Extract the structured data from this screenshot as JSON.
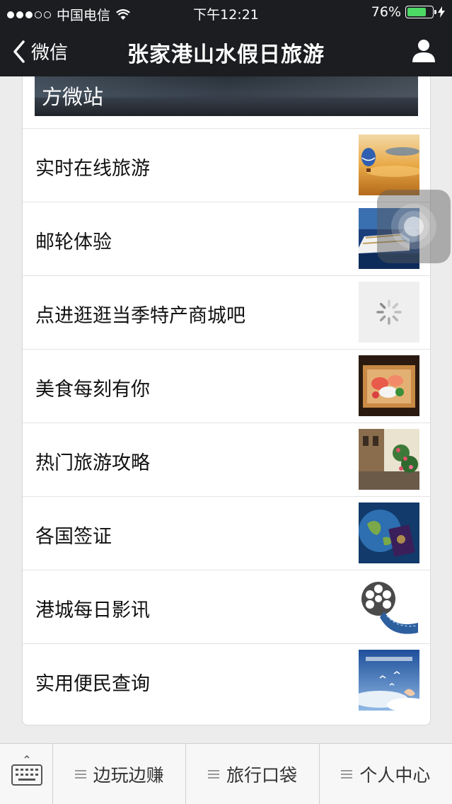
{
  "status_bar": {
    "carrier": "中国电信",
    "time": "下午12:21",
    "battery": "76%",
    "battery_level": 0.76,
    "signal_bars_filled": 3,
    "signal_bars_total": 5,
    "battery_color": "#4cd964"
  },
  "nav": {
    "back_label": "微信",
    "title": "张家港山水假日旅游",
    "profile_icon": "person-icon"
  },
  "banner": {
    "text": "方微站"
  },
  "list": [
    {
      "label": "实时在线旅游",
      "thumb": "hot-air-balloon-sunset-image"
    },
    {
      "label": "邮轮体验",
      "thumb": "cruise-ship-image"
    },
    {
      "label": "点进逛逛当季特产商城吧",
      "thumb": "loading-spinner"
    },
    {
      "label": "美食每刻有你",
      "thumb": "sashimi-platter-image"
    },
    {
      "label": "热门旅游攻略",
      "thumb": "street-flowers-image"
    },
    {
      "label": "各国签证",
      "thumb": "globe-passport-image"
    },
    {
      "label": "港城每日影讯",
      "thumb": "film-reel-image"
    },
    {
      "label": "实用便民查询",
      "thumb": "sky-birds-image"
    }
  ],
  "bottom_menu": {
    "keyboard_icon": "keyboard-icon",
    "items": [
      {
        "label": "边玩边赚"
      },
      {
        "label": "旅行口袋"
      },
      {
        "label": "个人中心"
      }
    ]
  },
  "colors": {
    "topbar": "#1b1d20",
    "background": "#ececec",
    "card": "#ffffff"
  }
}
